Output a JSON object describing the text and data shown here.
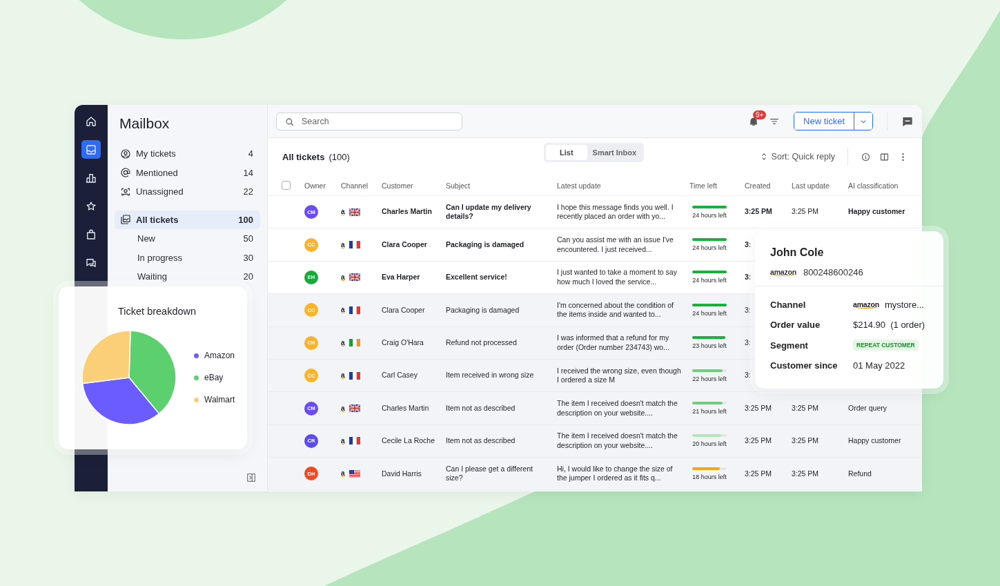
{
  "rail": {
    "items": [
      {
        "selected": false
      },
      {
        "selected": true
      },
      {
        "selected": false
      },
      {
        "selected": false
      },
      {
        "selected": false
      },
      {
        "selected": false
      }
    ]
  },
  "sidebar": {
    "title": "Mailbox",
    "items": [
      {
        "label": "My tickets",
        "count": "4",
        "selected": false
      },
      {
        "label": "Mentioned",
        "count": "14",
        "selected": false
      },
      {
        "label": "Unassigned",
        "count": "22",
        "selected": false
      },
      {
        "label": "All tickets",
        "count": "100",
        "selected": true,
        "children": [
          {
            "label": "New",
            "count": "50",
            "selected": false
          },
          {
            "label": "In progress",
            "count": "30",
            "selected": false
          },
          {
            "label": "Waiting",
            "count": "20",
            "selected": false
          }
        ]
      }
    ]
  },
  "topbar": {
    "search": {
      "placeholder": "Search"
    },
    "notifications_badge": "9+",
    "new_ticket_button": "New ticket"
  },
  "toolbar": {
    "title": "All tickets",
    "count": "(100)",
    "view_tabs": [
      {
        "label": "List",
        "selected": true
      },
      {
        "label": "Smart Inbox",
        "selected": false
      }
    ],
    "sort": "Sort: Quick reply"
  },
  "table": {
    "select_all": {
      "checked": false
    },
    "columns": [
      "Owner",
      "Channel",
      "Customer",
      "Subject",
      "Latest update",
      "Time left",
      "Created",
      "Last update",
      "AI classification"
    ],
    "rows": [
      {
        "owner": "CM",
        "color": "#6a4cf6",
        "channel": "a",
        "flag": {
          "kind": "uk"
        },
        "customer": "Charles Martin",
        "subject": "Can I update my delivery details?",
        "latest_update": "I hope this message finds you well. I recently placed an order with yo...",
        "level": 1,
        "time_left": "24 hours left",
        "created": "3:25 PM",
        "last_update": "3:25 PM",
        "ai_classification": "Happy customer",
        "unread": true
      },
      {
        "owner": "CC",
        "color": "#f9b429",
        "channel": "a",
        "flag": {
          "kind": "fr"
        },
        "customer": "Clara Cooper",
        "subject": "Packaging is damaged",
        "latest_update": "Can you assist me with an issue I've encountered. I just received...",
        "level": 1,
        "time_left": "24 hours left",
        "created": "3:",
        "unread": true
      },
      {
        "owner": "EH",
        "color": "#19a83a",
        "channel": "a",
        "flag": {
          "kind": "uk"
        },
        "customer": "Eva Harper",
        "subject": "Excellent service!",
        "latest_update": "I just wanted to take a moment to say how much I loved the service...",
        "level": 1,
        "time_left": "24 hours left",
        "created": "3:",
        "unread": true
      },
      {
        "owner": "CC",
        "color": "#f9b429",
        "channel": "a",
        "flag": {
          "kind": "fr"
        },
        "customer": "Clara Cooper",
        "subject": "Packaging is damaged",
        "latest_update": "I'm concerned about the condition of the items inside and wanted to...",
        "level": 1,
        "time_left": "24 hours left",
        "created": "3:",
        "unread": false
      },
      {
        "owner": "CH",
        "color": "#f9b429",
        "channel": "a",
        "flag": {
          "kind": "ie"
        },
        "customer": "Craig O'Hara",
        "subject": "Refund not processed",
        "latest_update": "I was informed that a refund for my order (Order number 234743) wo...",
        "level": 0.96,
        "time_left": "23 hours left",
        "created": "3:",
        "unread": false
      },
      {
        "owner": "CC",
        "color": "#f9b429",
        "channel": "a",
        "flag": {
          "kind": "fr"
        },
        "customer": "Carl Casey",
        "subject": "Item received in wrong size",
        "latest_update": "I received the wrong size, even though I ordered a size M",
        "level": 0.88,
        "time_left": "22 hours left",
        "created": "3:",
        "unread": false
      },
      {
        "owner": "CM",
        "color": "#6a4cf6",
        "channel": "a",
        "flag": {
          "kind": "uk"
        },
        "customer": "Charles Martin",
        "subject": "Item not as described",
        "latest_update": "The item I received doesn't match the description on your website....",
        "level": 0.87,
        "time_left": "21 hours left",
        "created": "3:25 PM",
        "last_update": "3:25 PM",
        "ai_classification": "Order query",
        "unread": false
      },
      {
        "owner": "CR",
        "color": "#5a4cf0",
        "channel": "a",
        "flag": {
          "kind": "fr"
        },
        "customer": "Cecile La Roche",
        "subject": "Item not as described",
        "latest_update": "The item I received doesn't match the description on your website....",
        "level": 0.83,
        "time_left": "20 hours left",
        "created": "3:25 PM",
        "last_update": "3:25 PM",
        "ai_classification": "Happy customer",
        "unread": false
      },
      {
        "owner": "DH",
        "color": "#f04a23",
        "channel": "a",
        "flag": {
          "kind": "us"
        },
        "customer": "David Harris",
        "subject": "Can I please get a different size?",
        "latest_update": "Hi, I would like to change the size of the jumper I ordered as it fits q...",
        "level": 0.8,
        "time_left": "18 hours left",
        "created": "3:25 PM",
        "last_update": "3:25 PM",
        "ai_classification": "Refund",
        "unread": false
      }
    ]
  },
  "breakdown_card": {
    "title": "Ticket breakdown",
    "legend": [
      {
        "label": "Amazon",
        "color": "#6b5cff"
      },
      {
        "label": "eBay",
        "color": "#5ccf6e"
      },
      {
        "label": "Walmart",
        "color": "#fbcf78"
      }
    ]
  },
  "customer_card": {
    "name": "John Cole",
    "store_logo": "amazon",
    "order_id": "800248600246",
    "fields": [
      {
        "label": "Channel",
        "kind": "store",
        "logo": "amazon",
        "value": "mystore..."
      },
      {
        "label": "Order value",
        "kind": "text",
        "value": "$214.90  (1 order)"
      },
      {
        "label": "Segment",
        "kind": "badge",
        "value": "REPEAT CUSTOMER"
      },
      {
        "label": "Customer since",
        "kind": "text",
        "value": "01 May 2022"
      }
    ]
  }
}
